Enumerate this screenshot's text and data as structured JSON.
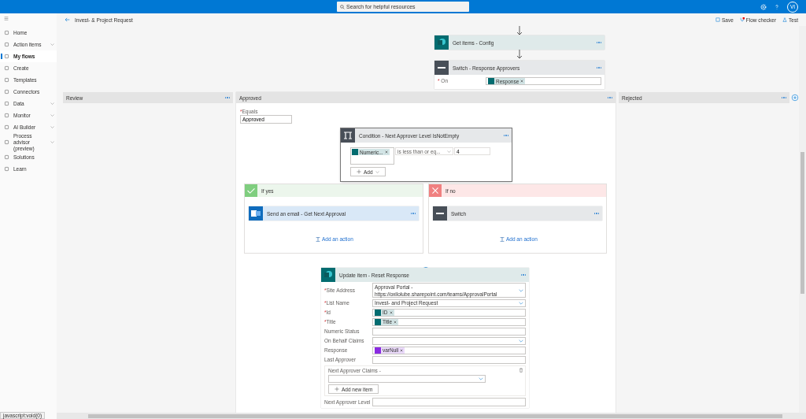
{
  "topbar": {
    "search_placeholder": "Search for helpful resources",
    "avatar": "VI"
  },
  "sidebar": {
    "items": [
      {
        "label": "Home",
        "selected": false,
        "expandable": false
      },
      {
        "label": "Action items",
        "selected": false,
        "expandable": true
      },
      {
        "label": "My flows",
        "selected": true,
        "expandable": false
      },
      {
        "label": "Create",
        "selected": false,
        "expandable": false
      },
      {
        "label": "Templates",
        "selected": false,
        "expandable": false
      },
      {
        "label": "Connectors",
        "selected": false,
        "expandable": false
      },
      {
        "label": "Data",
        "selected": false,
        "expandable": true
      },
      {
        "label": "Monitor",
        "selected": false,
        "expandable": true
      },
      {
        "label": "AI Builder",
        "selected": false,
        "expandable": true
      },
      {
        "label": "Process advisor (preview)",
        "selected": false,
        "expandable": true
      },
      {
        "label": "Solutions",
        "selected": false,
        "expandable": false
      },
      {
        "label": "Learn",
        "selected": false,
        "expandable": false
      }
    ]
  },
  "command_bar": {
    "title": "Invest- & Project Request",
    "actions": [
      {
        "label": "Save",
        "kind": "save",
        "alert": false
      },
      {
        "label": "Flow checker",
        "kind": "checker",
        "alert": true
      },
      {
        "label": "Test",
        "kind": "test",
        "alert": false
      }
    ]
  },
  "required_mark": "*",
  "flow": {
    "get_items": {
      "title": "Get items - Config"
    },
    "switch": {
      "title": "Switch - Response Approvers",
      "on_label": "On",
      "on_token": {
        "label": "Response",
        "color": "#036c70"
      }
    },
    "cases": [
      {
        "title": "Review"
      },
      {
        "title": "Approved"
      },
      {
        "title": "Rejected"
      }
    ],
    "approved": {
      "equals_label": "Equals",
      "equals_value": "Approved",
      "condition": {
        "title": "Condition - Next Approver Level IsNotEmpty",
        "token": {
          "label": "Numeric...",
          "color": "#036c70"
        },
        "operator": "is less than or eq...",
        "value": "4",
        "add_label": "Add"
      },
      "if_yes": {
        "title": "If yes",
        "action": "Send an email - Get Next Approval",
        "add_action": "Add an action"
      },
      "if_no": {
        "title": "If no",
        "action": "Switch",
        "add_action": "Add an action"
      },
      "update_item": {
        "title": "Update item - Reset Response",
        "fields": [
          {
            "label": "Site Address",
            "required": true,
            "kind": "dropdown",
            "lines": [
              "Approval Portal -",
              "https://oxilolube.sharepoint.com/teams/ApprovalPortal"
            ]
          },
          {
            "label": "List Name",
            "required": true,
            "kind": "dropdown",
            "lines": [
              "Invest- and Project Request"
            ]
          },
          {
            "label": "Id",
            "required": true,
            "kind": "token",
            "token": {
              "label": "ID",
              "color": "#036c70"
            }
          },
          {
            "label": "Title",
            "required": true,
            "kind": "token",
            "token": {
              "label": "Title",
              "color": "#036c70"
            }
          },
          {
            "label": "Numeric Status",
            "required": false,
            "kind": "text"
          },
          {
            "label": "On Behalf Claims",
            "required": false,
            "kind": "dropdown"
          },
          {
            "label": "Response",
            "required": false,
            "kind": "token",
            "token": {
              "label": "varNull",
              "color": "#8a2be2"
            }
          },
          {
            "label": "Last Approver",
            "required": false,
            "kind": "text"
          },
          {
            "label": "Next Approver Claims -",
            "required": false,
            "kind": "array",
            "add_label": "Add new item"
          },
          {
            "label": "Next Approver Level",
            "required": false,
            "kind": "text"
          }
        ]
      }
    }
  },
  "status_bar": "javascript:void(0)"
}
